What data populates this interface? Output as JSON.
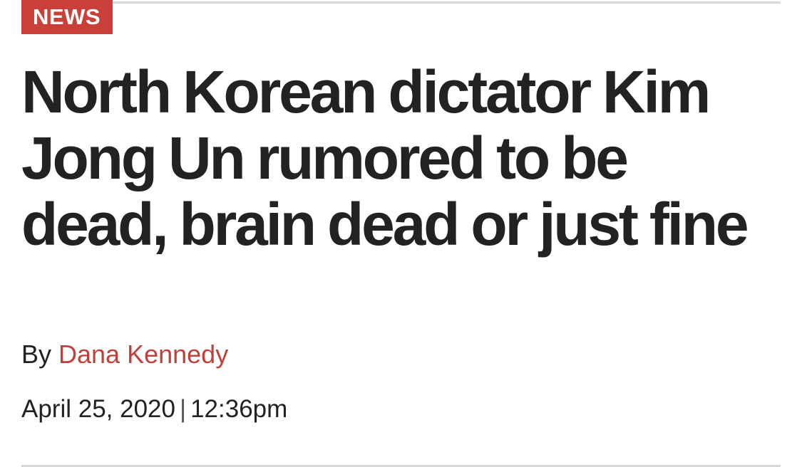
{
  "article": {
    "category": "NEWS",
    "headline": "North Korean dictator Kim Jong Un rumored to be dead, brain dead or just fine",
    "byline_prefix": "By",
    "author": "Dana Kennedy",
    "date": "April 25, 2020",
    "separator": "|",
    "time": "12:36pm"
  },
  "colors": {
    "accent": "#c9403a",
    "text": "#222222",
    "rule": "#d7d7d7"
  }
}
